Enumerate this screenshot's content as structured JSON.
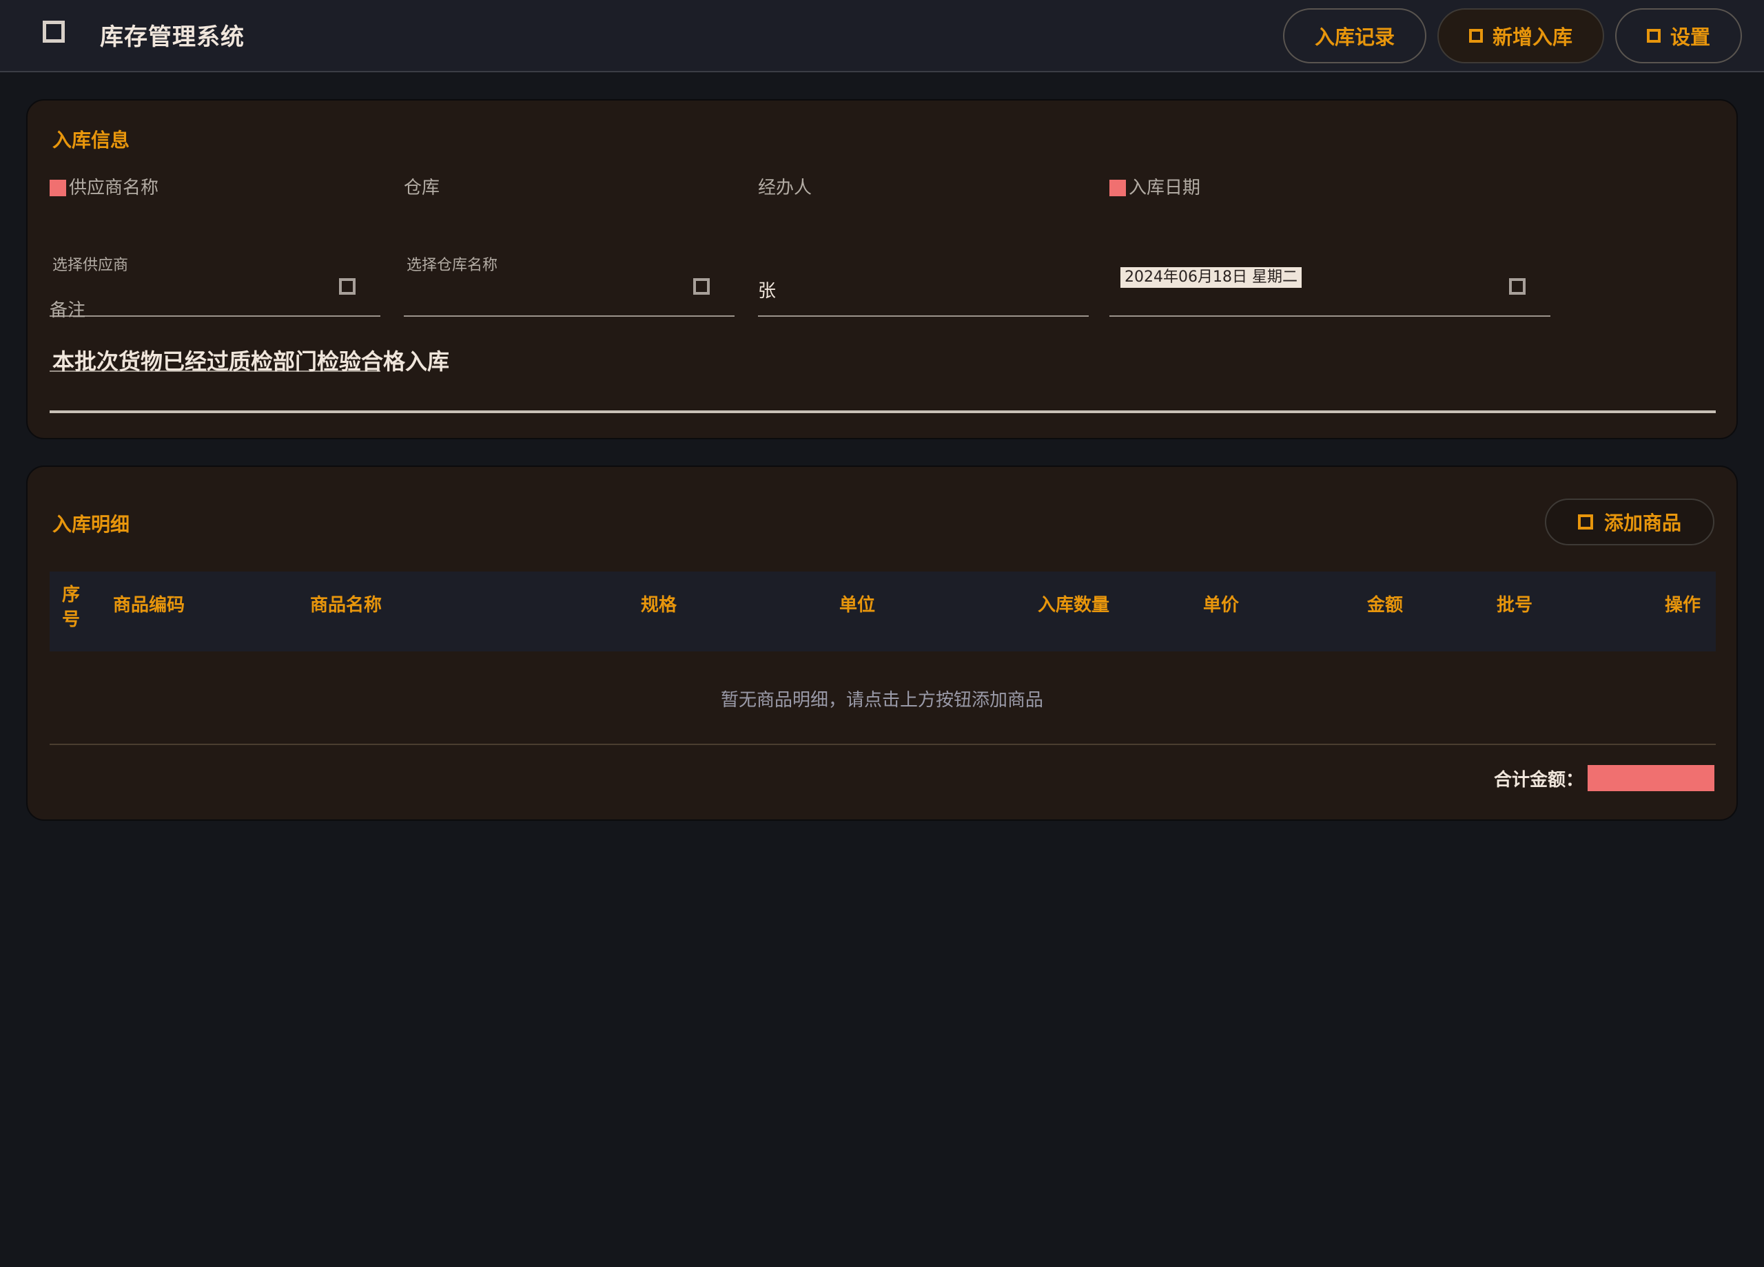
{
  "header": {
    "title": "库存管理系统",
    "brand_icon": "box-icon",
    "nav": [
      {
        "label": "入库记录",
        "icon": "",
        "active": false
      },
      {
        "label": "新增入库",
        "icon": "plus-icon",
        "active": true
      },
      {
        "label": "设置",
        "icon": "gear-icon",
        "active": false
      }
    ]
  },
  "form": {
    "title": "入库信息",
    "fields": {
      "supplier": {
        "label": "供应商名称",
        "placeholder": "选择供应商",
        "required": true
      },
      "warehouse": {
        "label": "仓库",
        "placeholder": "选择仓库名称",
        "required": false
      },
      "operator": {
        "label": "经办人",
        "value": "张",
        "required": false
      },
      "date": {
        "label": "入库日期",
        "value": "2024年06月18日 星期二",
        "required": true
      }
    },
    "remark": {
      "label": "备注",
      "value": "本批次货物已经过质检部门检验合格入库"
    }
  },
  "details": {
    "title": "入库明细",
    "add_label": "添加商品",
    "columns": [
      "序号",
      "商品编码",
      "商品名称",
      "规格",
      "单位",
      "入库数量",
      "单价",
      "金额",
      "批号",
      "操作"
    ],
    "empty_message": "暂无商品明细，请点击上方按钮添加商品",
    "total_label": "合计金额：",
    "total_value": "",
    "colors": {
      "accent": "#e8960c",
      "danger": "#f07070",
      "panel": "#221914",
      "background": "#14161b"
    }
  }
}
